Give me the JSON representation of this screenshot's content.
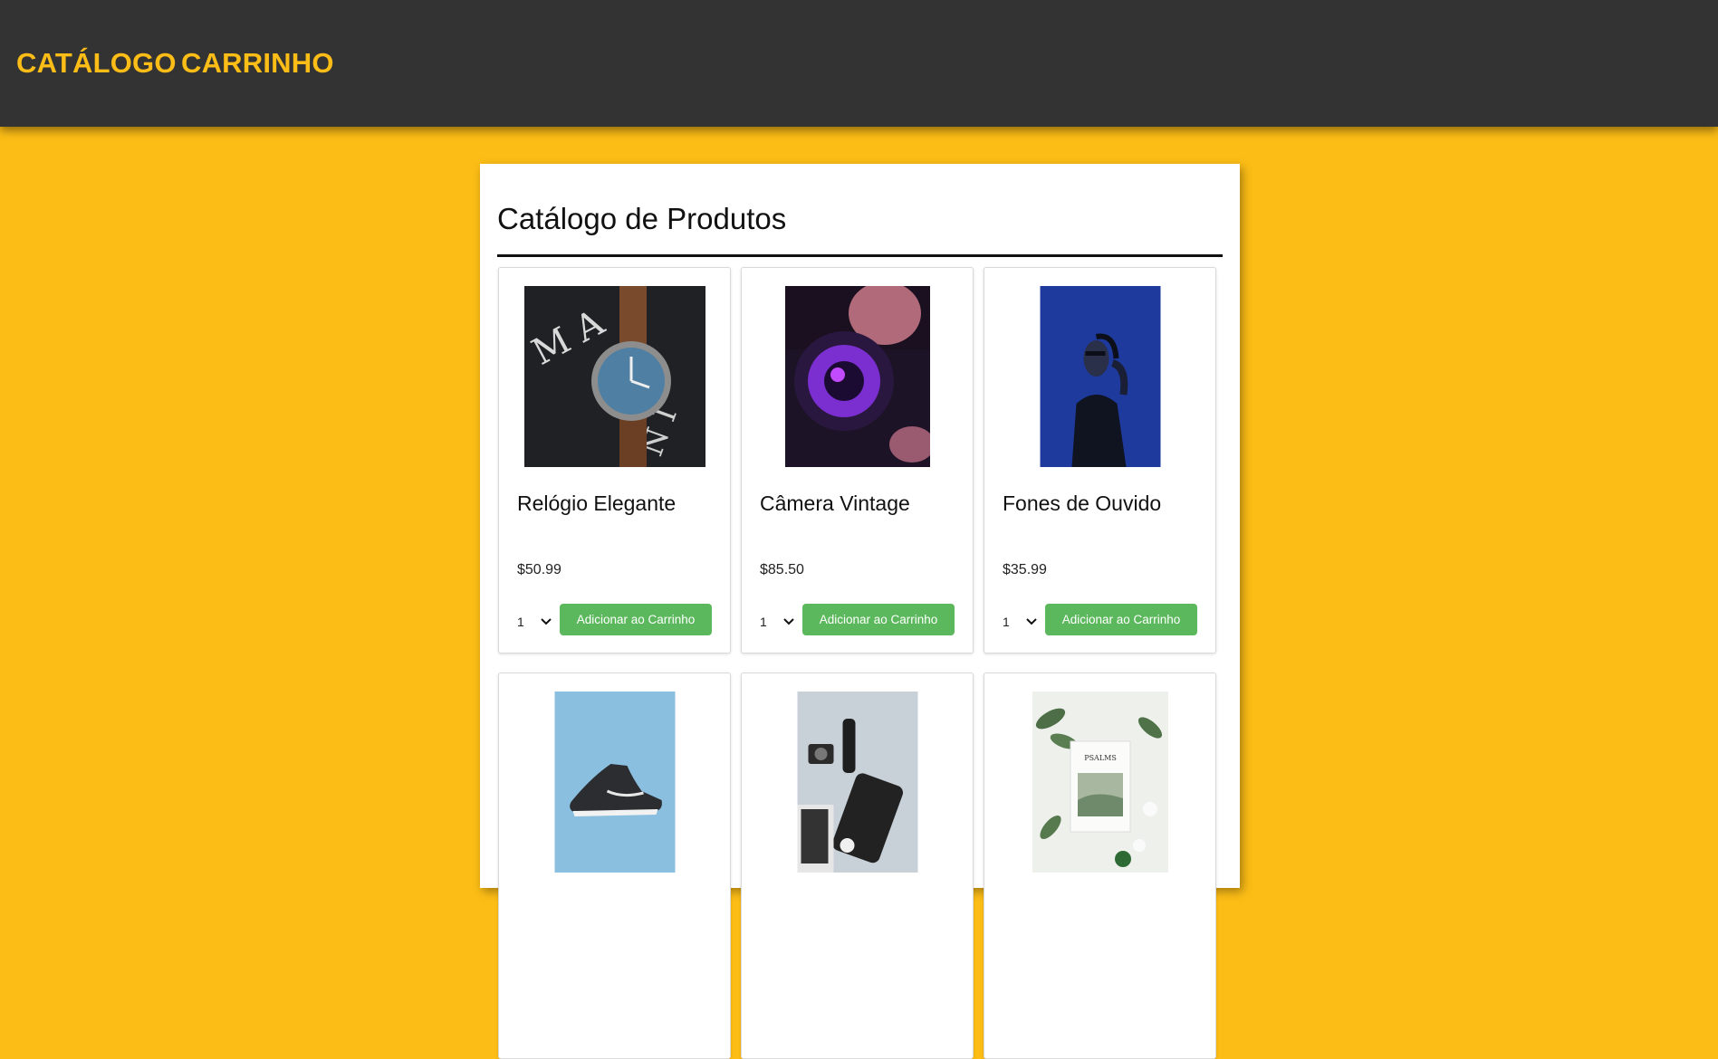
{
  "nav": {
    "catalog_label": "CATÁLOGO",
    "cart_label": "CARRINHO"
  },
  "page": {
    "title": "Catálogo de Produtos"
  },
  "products": [
    {
      "name": "Relógio Elegante",
      "price": "$50.99",
      "qty": "1",
      "button_label": "Adicionar ao Carrinho",
      "image": "wristwatch-photo"
    },
    {
      "name": "Câmera Vintage",
      "price": "$85.50",
      "qty": "1",
      "button_label": "Adicionar ao Carrinho",
      "image": "camera-lens-photo"
    },
    {
      "name": "Fones de Ouvido",
      "price": "$35.99",
      "qty": "1",
      "button_label": "Adicionar ao Carrinho",
      "image": "headphones-woman-photo"
    },
    {
      "image": "sneaker-photo"
    },
    {
      "image": "desk-gadgets-photo"
    },
    {
      "image": "psalms-book-photo",
      "image_text": "PSALMS"
    }
  ],
  "colors": {
    "background": "#fcbd16",
    "topbar": "#333333",
    "nav_text": "#fcbd16",
    "button": "#5cb85c"
  }
}
